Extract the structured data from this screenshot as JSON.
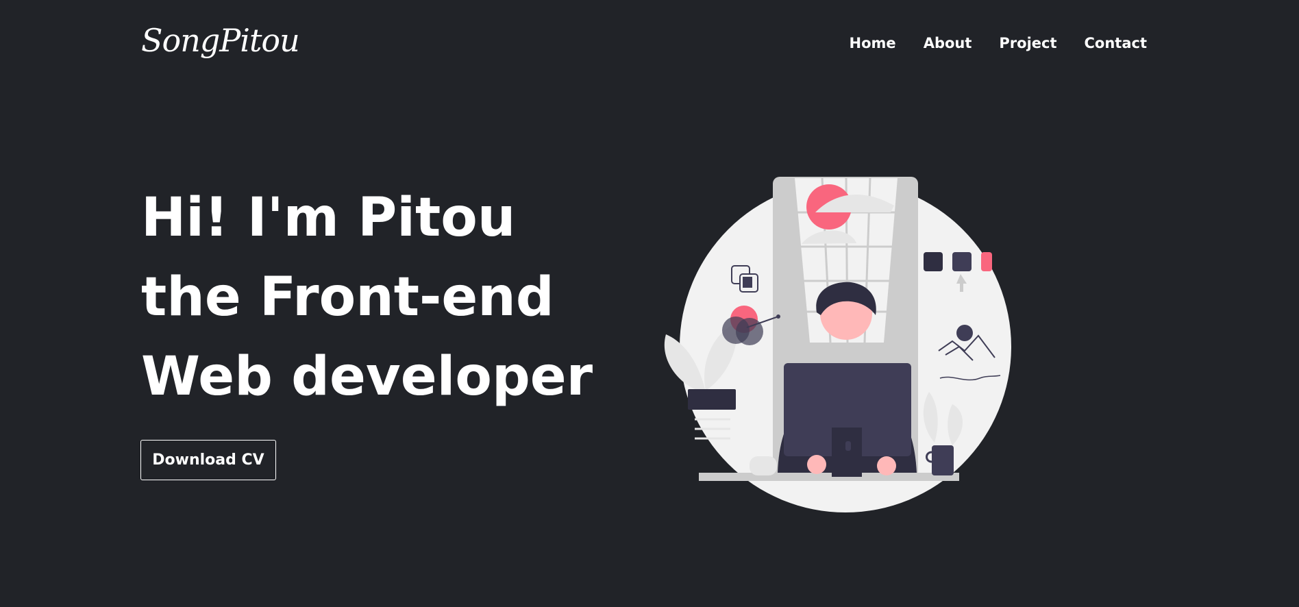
{
  "header": {
    "logo_text": "SongPitou",
    "nav": {
      "home": "Home",
      "about": "About",
      "project": "Project",
      "contact": "Contact"
    }
  },
  "hero": {
    "line1": "Hi! I'm Pitou",
    "line2": "the Front-end",
    "line3": "Web developer",
    "cta_label": "Download CV"
  },
  "colors": {
    "background": "#212328",
    "accent": "#f9667e",
    "circle": "#f2f2f2",
    "dark_navy": "#3f3d56"
  },
  "icons": {
    "illustration": "developer-at-desk-illustration"
  }
}
